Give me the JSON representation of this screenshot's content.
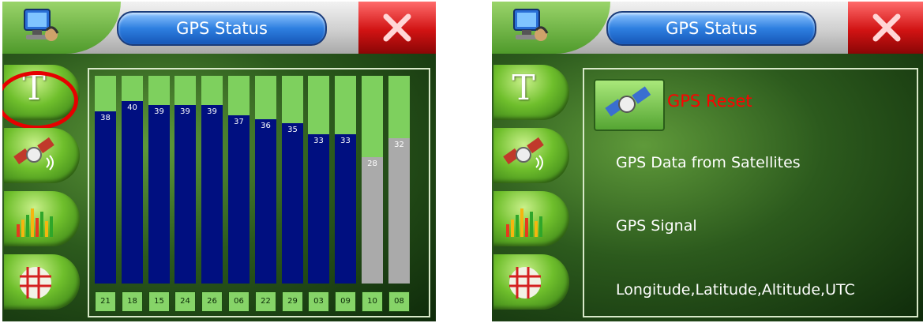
{
  "left_screen": {
    "title": "GPS Status",
    "sidebar": {
      "text_button_label": "T"
    },
    "signal_chart": {
      "satellites": [
        {
          "id": "21",
          "snr": "38",
          "level": 0.83,
          "status": "strong"
        },
        {
          "id": "18",
          "snr": "40",
          "level": 0.88,
          "status": "strong"
        },
        {
          "id": "15",
          "snr": "39",
          "level": 0.86,
          "status": "strong"
        },
        {
          "id": "24",
          "snr": "39",
          "level": 0.86,
          "status": "strong"
        },
        {
          "id": "26",
          "snr": "39",
          "level": 0.86,
          "status": "strong"
        },
        {
          "id": "06",
          "snr": "37",
          "level": 0.81,
          "status": "strong"
        },
        {
          "id": "22",
          "snr": "36",
          "level": 0.79,
          "status": "strong"
        },
        {
          "id": "29",
          "snr": "35",
          "level": 0.77,
          "status": "strong"
        },
        {
          "id": "03",
          "snr": "33",
          "level": 0.72,
          "status": "strong"
        },
        {
          "id": "09",
          "snr": "33",
          "level": 0.72,
          "status": "strong"
        },
        {
          "id": "10",
          "snr": "28",
          "level": 0.61,
          "status": "weak"
        },
        {
          "id": "08",
          "snr": "32",
          "level": 0.7,
          "status": "weak"
        }
      ]
    }
  },
  "right_screen": {
    "title": "GPS Status",
    "sidebar": {
      "text_button_label": "T"
    },
    "reset_label": "GPS Reset",
    "info_lines": [
      "GPS Data from Satellites",
      "GPS Signal",
      "Longitude,Latitude,Altitude,UTC"
    ]
  },
  "colors": {
    "title_pill": "#2e7fe0",
    "close_button": "#d11313",
    "bar_strong": "#000f80",
    "bar_weak": "#aaaaaa",
    "bar_background": "#7ed05e",
    "highlight_circle": "#e60000",
    "reset_label": "#ff0000"
  },
  "icons": [
    "computer-icon",
    "close-icon",
    "text-icon",
    "satellite-icon",
    "signal-bars-icon",
    "grid-map-icon"
  ]
}
